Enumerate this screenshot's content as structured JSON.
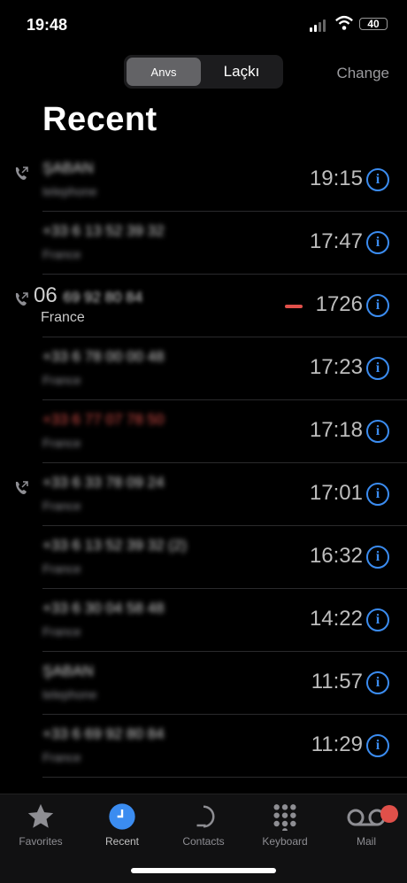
{
  "status": {
    "time": "19:48",
    "battery": "40"
  },
  "header": {
    "segments": [
      {
        "label": "Anvs",
        "active": true
      },
      {
        "label": "Laçkı",
        "active": false
      }
    ],
    "change_label": "Change",
    "title": "Recent"
  },
  "calls": [
    {
      "name": "ŞABAN",
      "sub": "telephone",
      "time": "19:15",
      "outgoing": true,
      "missed": false
    },
    {
      "name": "+33 6 13 52 39 32",
      "sub": "France",
      "time": "17:47",
      "outgoing": false,
      "missed": false
    },
    {
      "name_prefix": "06",
      "name": "69 92 80 84",
      "sub": "France",
      "time": "1726",
      "outgoing": true,
      "missed": false
    },
    {
      "name": "+33 6 78 00 00 48",
      "sub": "France",
      "time": "17:23",
      "outgoing": false,
      "missed": false
    },
    {
      "name": "+33 6 77 07 78 50",
      "sub": "France",
      "time": "17:18",
      "outgoing": false,
      "missed": true
    },
    {
      "name": "+33 6 33 78 09 24",
      "sub": "France",
      "time": "17:01",
      "outgoing": true,
      "missed": false
    },
    {
      "name": "+33 6 13 52 39 32 (2)",
      "sub": "France",
      "time": "16:32",
      "outgoing": false,
      "missed": false
    },
    {
      "name": "+33 6 30 04 58 48",
      "sub": "France",
      "time": "14:22",
      "outgoing": false,
      "missed": false
    },
    {
      "name": "ŞABAN",
      "sub": "telephone",
      "time": "11:57",
      "outgoing": false,
      "missed": false
    },
    {
      "name": "+33 6 69 92 80 84",
      "sub": "France",
      "time": "11:29",
      "outgoing": false,
      "missed": false
    }
  ],
  "tabs": [
    {
      "label": "Favorites",
      "icon": "star-icon",
      "active": false
    },
    {
      "label": "Recent",
      "icon": "clock-icon",
      "active": true
    },
    {
      "label": "Contacts",
      "icon": "person-icon",
      "active": false
    },
    {
      "label": "Keyboard",
      "icon": "keypad-icon",
      "active": false
    },
    {
      "label": "Mail",
      "icon": "voicemail-icon",
      "active": false
    }
  ],
  "colors": {
    "accent": "#3b8cf0",
    "missed": "#e0504a",
    "background": "#000000"
  }
}
